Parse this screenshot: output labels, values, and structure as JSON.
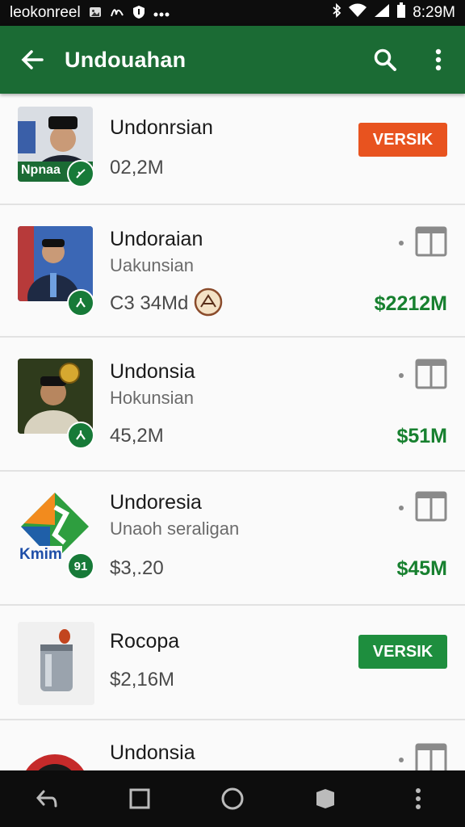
{
  "status_bar": {
    "left_text": "leokonreel",
    "time": "8:29M",
    "icons": [
      "image-icon",
      "handwriting-icon",
      "shield-icon",
      "more-dots-icon",
      "bluetooth-icon",
      "wifi-icon",
      "signal-icon",
      "battery-icon"
    ]
  },
  "app_bar": {
    "title": "Undouahan",
    "icons": [
      "back-arrow-icon",
      "search-icon",
      "overflow-menu-icon"
    ],
    "color": "#1b6b34"
  },
  "items": [
    {
      "title": "Undonrsian",
      "subtitle": "",
      "meta": "02,2M",
      "thumb_text": "Npnaa",
      "button": "VERSIK",
      "button_color": "#e8531f"
    },
    {
      "title": "Undoraian",
      "subtitle": "Uakunsian",
      "meta": "C3 34Md",
      "price": "$2212M"
    },
    {
      "title": "Undonsia",
      "subtitle": "Hokunsian",
      "meta": "45,2M",
      "price": "$51M"
    },
    {
      "title": "Undoresia",
      "subtitle": "Unaoh seraligan",
      "meta": "$3,.20",
      "thumb_text": "Kmim",
      "badge_text": "91",
      "price": "$45M"
    },
    {
      "title": "Rocopa",
      "subtitle": "",
      "meta": "$2,16M",
      "button": "VERSIK",
      "button_color": "#1e8e3e"
    },
    {
      "title": "Undonsia",
      "subtitle": ""
    }
  ],
  "colors": {
    "accent_green": "#17802f",
    "price_green": "#17802f"
  },
  "nav_bar": {
    "icons": [
      "back-nav-icon",
      "recents-icon",
      "home-icon",
      "assistant-icon",
      "more-vert-icon"
    ]
  }
}
